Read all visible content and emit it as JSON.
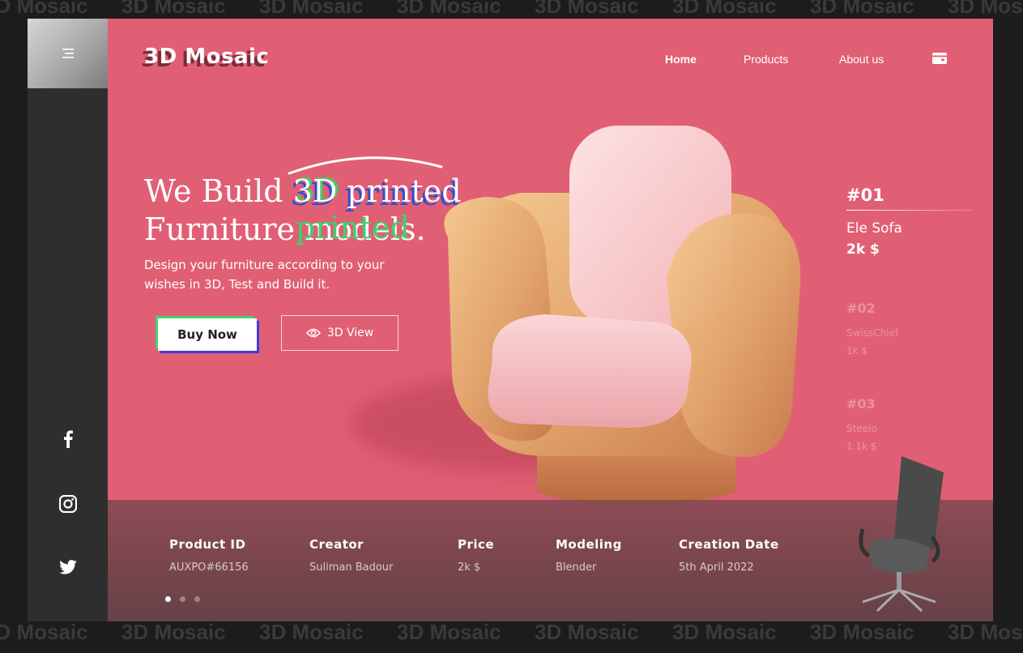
{
  "watermark": "3D Mosaic",
  "brand": {
    "logo": "3D Mosaic"
  },
  "nav": [
    {
      "label": "Home",
      "active": true
    },
    {
      "label": "Products",
      "active": false
    },
    {
      "label": "About us",
      "active": false
    }
  ],
  "hero": {
    "headline_before": "We Build ",
    "headline_highlight": "3D printed",
    "headline_line2": "Furniture models.",
    "subtitle": "Design your furniture according to your wishes in 3D, Test and Build it.",
    "buy_label": "Buy Now",
    "view_label": "3D View"
  },
  "products": [
    {
      "num": "#01",
      "name": "Ele Sofa",
      "price": "2k $",
      "active": true
    },
    {
      "num": "#02",
      "name": "SwissChief",
      "price": "1k $",
      "active": false
    },
    {
      "num": "#03",
      "name": "Steelo",
      "price": "1.1k $",
      "active": false
    }
  ],
  "details": [
    {
      "label": "Product ID",
      "value": "AUXPO#66156"
    },
    {
      "label": "Creator",
      "value": "Suliman Badour"
    },
    {
      "label": "Price",
      "value": "2k $"
    },
    {
      "label": "Modeling",
      "value": "Blender"
    },
    {
      "label": "Creation Date",
      "value": "5th April 2022"
    }
  ],
  "carousel": {
    "count": 3,
    "active": 0
  },
  "social": [
    "facebook-icon",
    "instagram-icon",
    "twitter-icon"
  ],
  "colors": {
    "hero": "#e15f74",
    "rail": "#2e2e2e",
    "accent_green": "#43d46f",
    "accent_blue": "#3a3be0"
  }
}
